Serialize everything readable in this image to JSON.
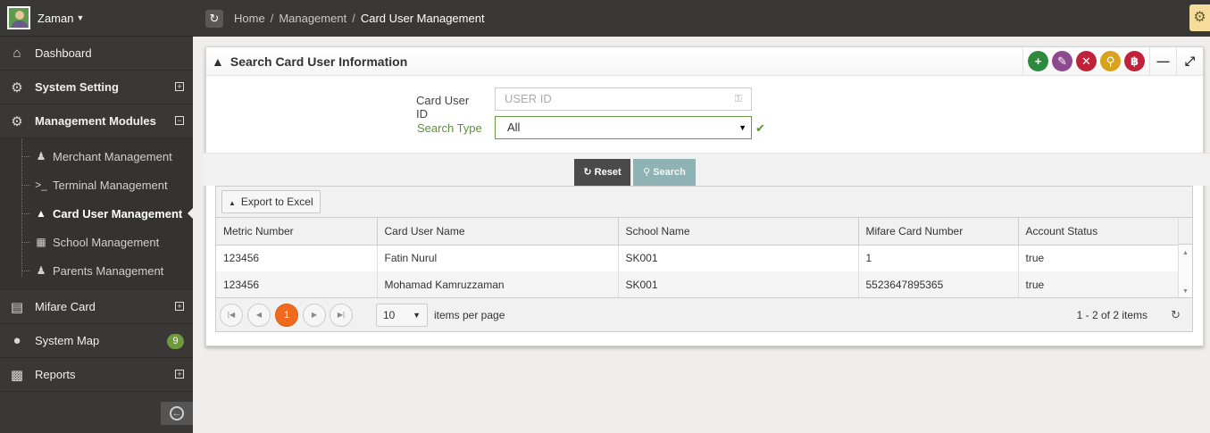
{
  "user": {
    "name": "Zaman"
  },
  "sidebar": {
    "items": [
      {
        "label": "Dashboard",
        "icon": "home-icon"
      },
      {
        "label": "System Setting",
        "icon": "gears-icon"
      },
      {
        "label": "Management Modules",
        "icon": "gears-icon"
      }
    ],
    "submenu": [
      {
        "label": "Merchant Management",
        "icon": "person-icon"
      },
      {
        "label": "Terminal Management",
        "icon": "terminal-icon"
      },
      {
        "label": "Card User Management",
        "icon": "graduation-cap-icon"
      },
      {
        "label": "School Management",
        "icon": "building-icon"
      },
      {
        "label": "Parents Management",
        "icon": "person-icon"
      }
    ],
    "bottom_items": [
      {
        "label": "Mifare Card",
        "icon": "card-icon"
      },
      {
        "label": "System Map",
        "icon": "map-marker-icon",
        "badge": "9"
      },
      {
        "label": "Reports",
        "icon": "bar-chart-icon"
      }
    ]
  },
  "breadcrumb": {
    "home": "Home",
    "section": "Management",
    "current": "Card User Management",
    "separator": "/"
  },
  "panel": {
    "title": "Search Card User Information"
  },
  "form": {
    "card_user_id_label": "Card User ID",
    "card_user_id_placeholder": "USER ID",
    "search_type_label": "Search Type",
    "search_type_value": "All"
  },
  "buttons": {
    "reset": "Reset",
    "search": "Search"
  },
  "grid": {
    "export_label": "Export to Excel",
    "columns": [
      "Metric Number",
      "Card User Name",
      "School Name",
      "Mifare Card Number",
      "Account Status"
    ],
    "rows": [
      [
        "123456",
        "Fatin Nurul",
        "SK001",
        "1",
        "true"
      ],
      [
        "123456",
        "Mohamad Kamruzzaman",
        "SK001",
        "5523647895365",
        "true"
      ]
    ],
    "pager": {
      "current_page": "1",
      "page_size": "10",
      "items_per_page": "items per page",
      "info": "1 - 2 of 2 items"
    }
  },
  "colors": {
    "add": "#2e8b3e",
    "edit": "#8e4a8e",
    "delete": "#c0223a",
    "find": "#d9a21e",
    "bitcoin": "#c0223a",
    "current_page": "#f06a1e",
    "sidebar_bg": "#393836"
  }
}
